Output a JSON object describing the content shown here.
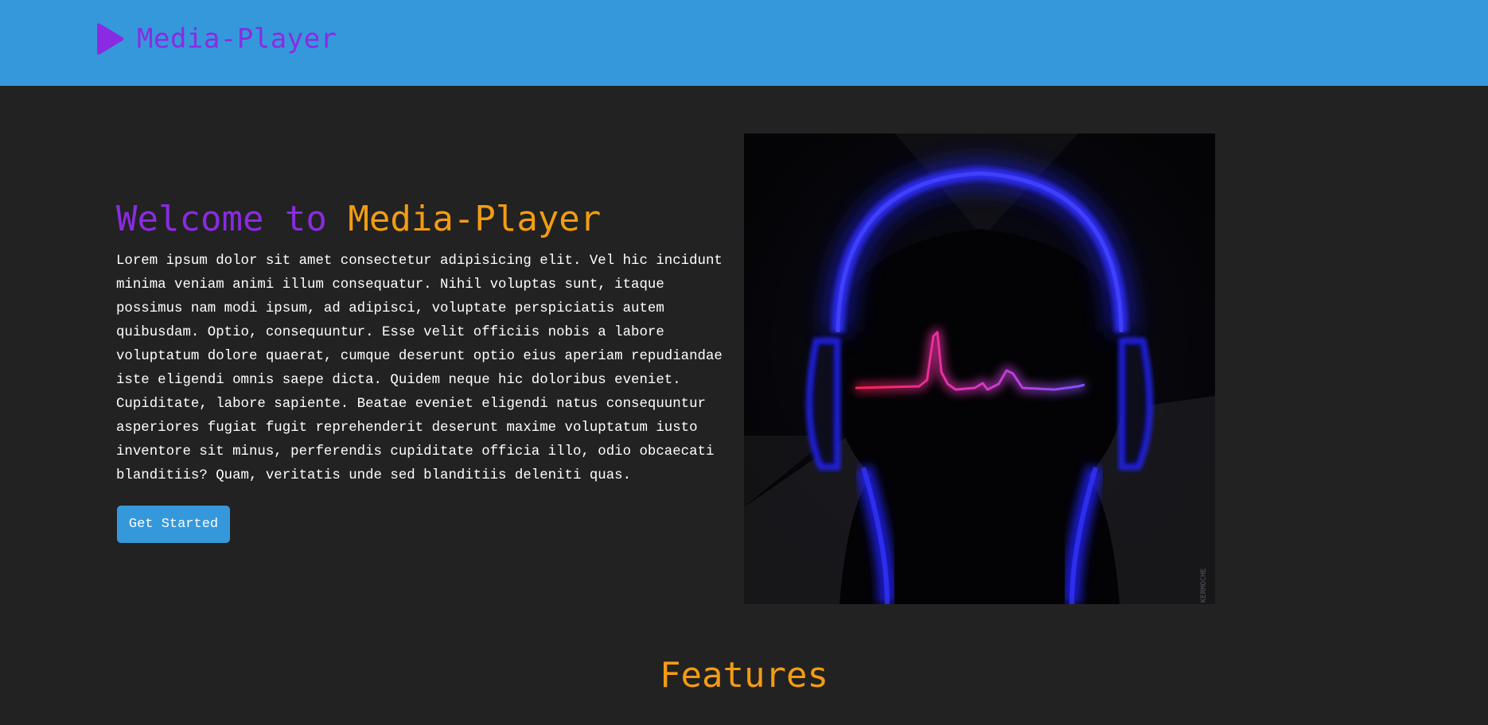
{
  "navbar": {
    "brand_name": "Media-Player",
    "brand_icon": "play-icon",
    "background_color": "#3598db",
    "brand_color": "#8a2be2"
  },
  "hero": {
    "title_part1": "Welcome to ",
    "title_part2": "Media-Player",
    "title_part1_color": "#8a2be2",
    "title_part2_color": "#f39c12",
    "body": "Lorem ipsum dolor sit amet consectetur adipisicing elit. Vel hic incidunt minima veniam animi illum consequatur. Nihil voluptas sunt, itaque possimus nam modi ipsum, ad adipisci, voluptate perspiciatis autem quibusdam. Optio, consequuntur. Esse velit officiis nobis a labore voluptatum dolore quaerat, cumque deserunt optio eius aperiam repudiandae iste eligendi omnis saepe dicta. Quidem neque hic doloribus eveniet. Cupiditate, labore sapiente. Beatae eveniet eligendi natus consequuntur asperiores fugiat fugit reprehenderit deserunt maxime voluptatum iusto inventore sit minus, perferendis cupiditate officia illo, odio obcaecati blanditiis? Quam, veritatis unde sed blanditiis deleniti quas.",
    "cta_label": "Get Started",
    "image": {
      "description": "headphones-soundwave-illustration",
      "signature": "KERMOCHE"
    }
  },
  "sections": {
    "features_heading": "Features"
  },
  "theme": {
    "page_background": "#222222",
    "accent": "#3598db"
  }
}
